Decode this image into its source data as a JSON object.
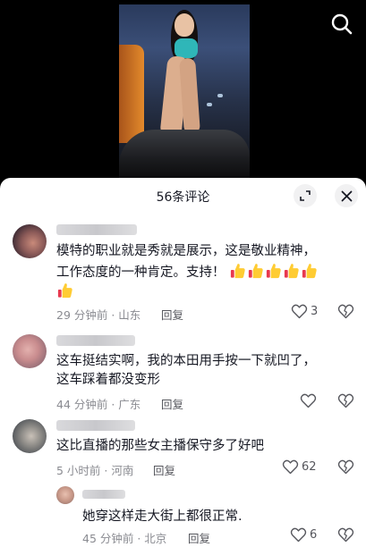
{
  "sheet": {
    "title": "56条评论"
  },
  "icons": {
    "search": "search-icon",
    "expand": "expand-icon",
    "close": "close-icon",
    "like": "heart-outline-icon",
    "dislike": "heart-broken-icon",
    "thumbs_up_emoji": "thumbs-up-emoji"
  },
  "colors": {
    "sheet_bg": "#ffffff",
    "text_primary": "#161823",
    "text_secondary": "#8a8b91",
    "emoji_yellow": "#ffcc33",
    "emoji_red": "#e8394f"
  },
  "comments": [
    {
      "text_line1": "模特的职业就是秀就是展示，这是敬业精神，",
      "text_line2": "工作态度的一种肯定。支持！",
      "emoji_count": 6,
      "meta": "29 分钟前 · 山东",
      "reply_label": "回复",
      "likes": "3"
    },
    {
      "text_line1": "这车挺结实啊，我的本田用手按一下就凹了，",
      "text_line2": "这车踩着都没变形",
      "meta": "44 分钟前 · 广东",
      "reply_label": "回复",
      "likes": ""
    },
    {
      "text_line1": "这比直播的那些女主播保守多了好吧",
      "meta": "5 小时前 · 河南",
      "reply_label": "回复",
      "likes": "62"
    },
    {
      "text_line1": "她穿这样走大街上都很正常.",
      "meta": "45 分钟前 · 北京",
      "reply_label": "回复",
      "likes": "6"
    }
  ]
}
